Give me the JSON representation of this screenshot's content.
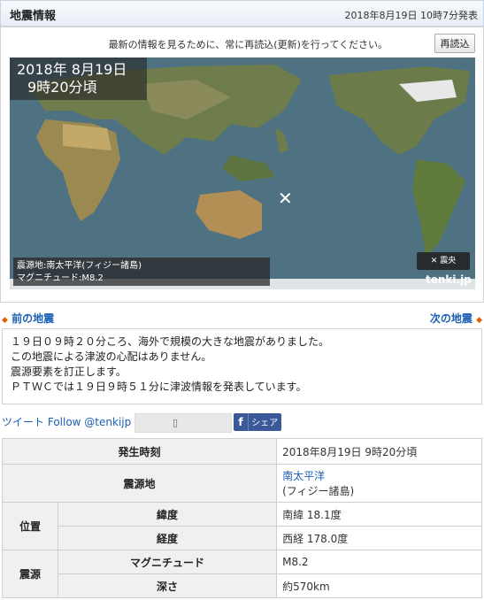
{
  "header": {
    "title": "地震情報",
    "issued": "2018年8月19日 10時7分発表"
  },
  "notice": "最新の情報を見るために、常に再読込(更新)を行ってください。",
  "reload_label": "再読込",
  "map": {
    "datetime_line1": "2018年  8月19日",
    "datetime_line2": "9時20分頃",
    "epicenter_line": "震源地:南太平洋(フィジー諸島)",
    "magnitude_line": "マグニチュード:M8.2",
    "legend": "✕ 震央",
    "brand": "tenki.jp"
  },
  "nav": {
    "prev": "前の地震",
    "next": "次の地震"
  },
  "message": [
    "１９日０９時２０分ころ、海外で規模の大きな地震がありました。",
    "この地震による津波の心配はありません。",
    "震源要素を訂正します。",
    "ＰＴＷＣでは１９日９時５１分に津波情報を発表しています。"
  ],
  "social": {
    "tweet": "ツイート",
    "follow": "Follow @tenkijp",
    "share": "シェア"
  },
  "table": {
    "time_label": "発生時刻",
    "time_value": "2018年8月19日 9時20分頃",
    "epicenter_label": "震源地",
    "epicenter_link": "南太平洋",
    "epicenter_sub": "(フィジー諸島)",
    "position_label": "位置",
    "lat_label": "緯度",
    "lat_value": "南緯 18.1度",
    "lon_label": "経度",
    "lon_value": "西経 178.0度",
    "source_label": "震源",
    "mag_label": "マグニチュード",
    "mag_value": "M8.2",
    "depth_label": "深さ",
    "depth_value": "約570km"
  }
}
